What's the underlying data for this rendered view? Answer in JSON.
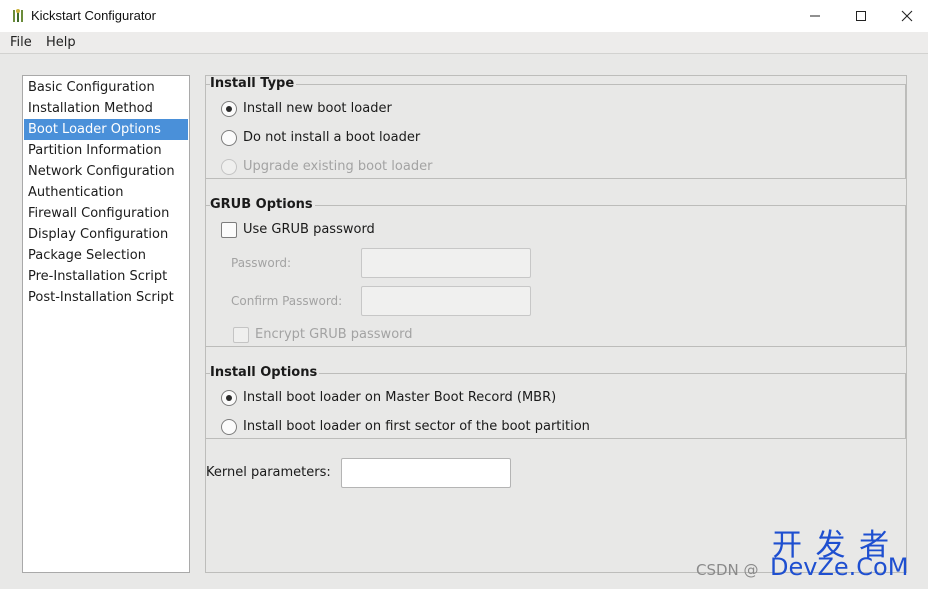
{
  "window": {
    "title": "Kickstart Configurator",
    "controls": {
      "minimize": "—",
      "maximize": "☐",
      "close": "✕"
    }
  },
  "menu": {
    "file": "File",
    "help": "Help"
  },
  "sidebar": {
    "items": [
      {
        "label": "Basic Configuration"
      },
      {
        "label": "Installation Method"
      },
      {
        "label": "Boot Loader Options"
      },
      {
        "label": "Partition Information"
      },
      {
        "label": "Network Configuration"
      },
      {
        "label": "Authentication"
      },
      {
        "label": "Firewall Configuration"
      },
      {
        "label": "Display Configuration"
      },
      {
        "label": "Package Selection"
      },
      {
        "label": "Pre-Installation Script"
      },
      {
        "label": "Post-Installation Script"
      }
    ],
    "selected": "Boot Loader Options"
  },
  "install_type": {
    "title": "Install Type",
    "options": [
      {
        "label": "Install new boot loader",
        "checked": true,
        "enabled": true
      },
      {
        "label": "Do not install a boot loader",
        "checked": false,
        "enabled": true
      },
      {
        "label": "Upgrade existing boot loader",
        "checked": false,
        "enabled": false
      }
    ]
  },
  "grub_options": {
    "title": "GRUB Options",
    "use_password_label": "Use GRUB password",
    "password_label": "Password:",
    "confirm_label": "Confirm Password:",
    "encrypt_label": "Encrypt GRUB password"
  },
  "install_options": {
    "title": "Install Options",
    "options": [
      {
        "label": "Install boot loader on Master Boot Record (MBR)",
        "checked": true
      },
      {
        "label": "Install boot loader on first sector of the boot partition",
        "checked": false
      }
    ]
  },
  "kernel": {
    "label": "Kernel parameters:",
    "value": ""
  },
  "watermark": {
    "line1": "开 发 者",
    "line2": "DevZe.CoM",
    "csdn": "CSDN @"
  },
  "colors": {
    "selection": "#4a90d9",
    "watermark": "#1e4fd0"
  }
}
